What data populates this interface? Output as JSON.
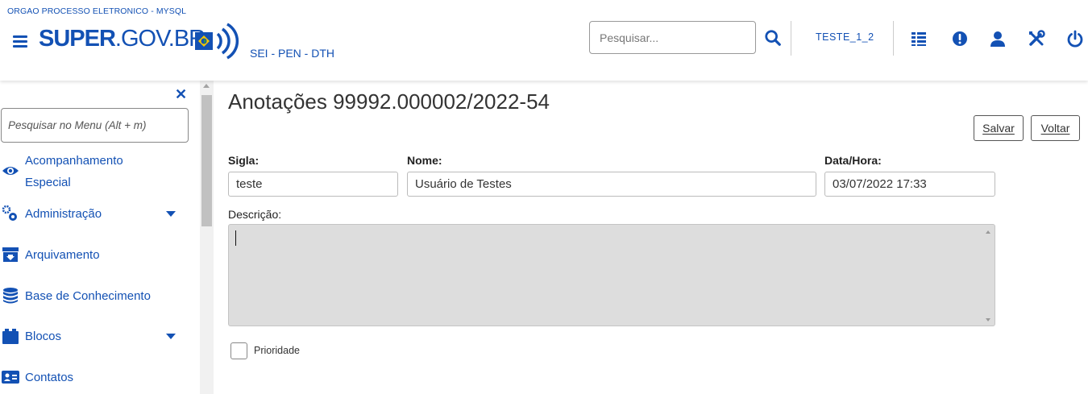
{
  "header": {
    "org_name": "ORGAO PROCESSO ELETRONICO - MYSQL",
    "logo_bold": "SUPER",
    "logo_light": ".GOV.BR",
    "logo_subtitle": "SEI - PEN - DTH",
    "search_placeholder": "Pesquisar...",
    "user_unit": "TESTE_1_2",
    "icons": [
      "menu-icon",
      "search-icon",
      "list-icon",
      "alert-icon",
      "user-icon",
      "tools-icon",
      "power-icon"
    ]
  },
  "sidebar": {
    "search_placeholder": "Pesquisar no Menu (Alt + m)",
    "items": [
      {
        "label_line1": "Acompanhamento",
        "label_line2": "Especial",
        "icon": "eye-icon",
        "has_submenu": false
      },
      {
        "label": "Administração",
        "icon": "gears-icon",
        "has_submenu": true
      },
      {
        "label": "Arquivamento",
        "icon": "archive-icon",
        "has_submenu": false
      },
      {
        "label": "Base de Conhecimento",
        "icon": "database-icon",
        "has_submenu": false
      },
      {
        "label": "Blocos",
        "icon": "cubes-icon",
        "has_submenu": true
      },
      {
        "label": "Contatos",
        "icon": "id-card-icon",
        "has_submenu": false
      }
    ]
  },
  "main": {
    "title": "Anotações 99992.000002/2022-54",
    "buttons": {
      "save": "Salvar",
      "back": "Voltar"
    },
    "fields": {
      "sigla_label": "Sigla:",
      "sigla_value": "teste",
      "nome_label": "Nome:",
      "nome_value": "Usuário de Testes",
      "datahora_label": "Data/Hora:",
      "datahora_value": "03/07/2022 17:33",
      "descricao_label": "Descrição:",
      "descricao_value": ""
    },
    "prioridade_label": "Prioridade",
    "prioridade_checked": false
  },
  "colors": {
    "primary": "#1351b4",
    "textarea_bg": "#dddddd"
  }
}
